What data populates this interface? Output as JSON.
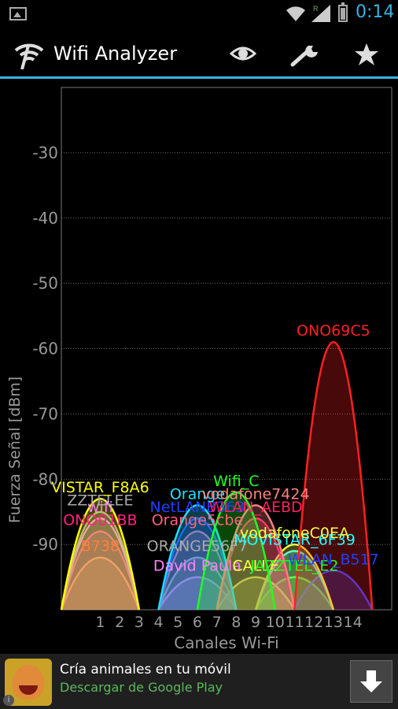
{
  "status_bar": {
    "time": "0:14",
    "network_badge": "R",
    "icons": [
      "image-icon",
      "wifi-icon",
      "signal-icon",
      "battery-icon"
    ]
  },
  "action_bar": {
    "title": "Wifi Analyzer",
    "actions": [
      "eye-icon",
      "wrench-icon",
      "star-icon"
    ],
    "accent": "#33b5e5"
  },
  "chart_data": {
    "type": "area",
    "xlabel": "Canales Wi-Fi",
    "ylabel": "Fuerza Señal [dBm]",
    "x_ticks": [
      "1",
      "2",
      "3",
      "4",
      "5",
      "6",
      "7",
      "8",
      "9",
      "10",
      "11",
      "12",
      "13",
      "14"
    ],
    "y_ticks": [
      "-30",
      "-40",
      "-50",
      "-60",
      "-70",
      "-80",
      "-90"
    ],
    "x_range": [
      -1,
      16
    ],
    "y_range": [
      -100,
      -20
    ],
    "grid": true,
    "series": [
      {
        "name": "ONO69C5",
        "channel": 13,
        "dbm": -59,
        "color": "#ff2020"
      },
      {
        "name": "VISTAR_F8A6",
        "channel": 1,
        "dbm": -83,
        "color": "#ffff00"
      },
      {
        "name": "Orange",
        "channel": 6,
        "dbm": -84,
        "color": "#20e0ff"
      },
      {
        "name": "Wifi_C",
        "channel": 8,
        "dbm": -82,
        "color": "#20ff20"
      },
      {
        "name": "vodafone7424",
        "channel": 9,
        "dbm": -84,
        "color": "#ff8080"
      },
      {
        "name": "ZZTELEE",
        "channel": 1,
        "dbm": -85,
        "color": "#aaaaaa"
      },
      {
        "name": "wifi",
        "channel": 1,
        "dbm": -86,
        "color": "#ff80ff"
      },
      {
        "name": "NetLANB363",
        "channel": 6,
        "dbm": -86,
        "color": "#2040ff"
      },
      {
        "name": "WLAN_AEBD",
        "channel": 9,
        "dbm": -86,
        "color": "#ff2060"
      },
      {
        "name": "ONO01BB",
        "channel": 1,
        "dbm": -88,
        "color": "#ff2080"
      },
      {
        "name": "Orange5cbe",
        "channel": 6,
        "dbm": -88,
        "color": "#ff6080"
      },
      {
        "name": "vodafoneC0EA",
        "channel": 11,
        "dbm": -90,
        "color": "#ffff40"
      },
      {
        "name": "MOVISTAR_6F39",
        "channel": 11,
        "dbm": -91,
        "color": "#20ffff"
      },
      {
        "name": "ORANGE56F7",
        "channel": 6,
        "dbm": -92,
        "color": "#aaaaaa"
      },
      {
        "name": "B738",
        "channel": 1,
        "dbm": -92,
        "color": "#ff8040"
      },
      {
        "name": "WLAN_B517",
        "channel": 13,
        "dbm": -94,
        "color": "#2040ff"
      },
      {
        "name": "David Paula",
        "channel": 6,
        "dbm": -95,
        "color": "#ff80ff"
      },
      {
        "name": "CALLE",
        "channel": 9,
        "dbm": -95,
        "color": "#ffff40"
      },
      {
        "name": "JAZZTEL_E2",
        "channel": 11,
        "dbm": -95,
        "color": "#20ff20"
      }
    ]
  },
  "ad": {
    "title": "Cría animales en tu móvil",
    "subtitle": "Descargar de Google Play",
    "info": "i",
    "download_icon": "download-arrow-icon"
  }
}
